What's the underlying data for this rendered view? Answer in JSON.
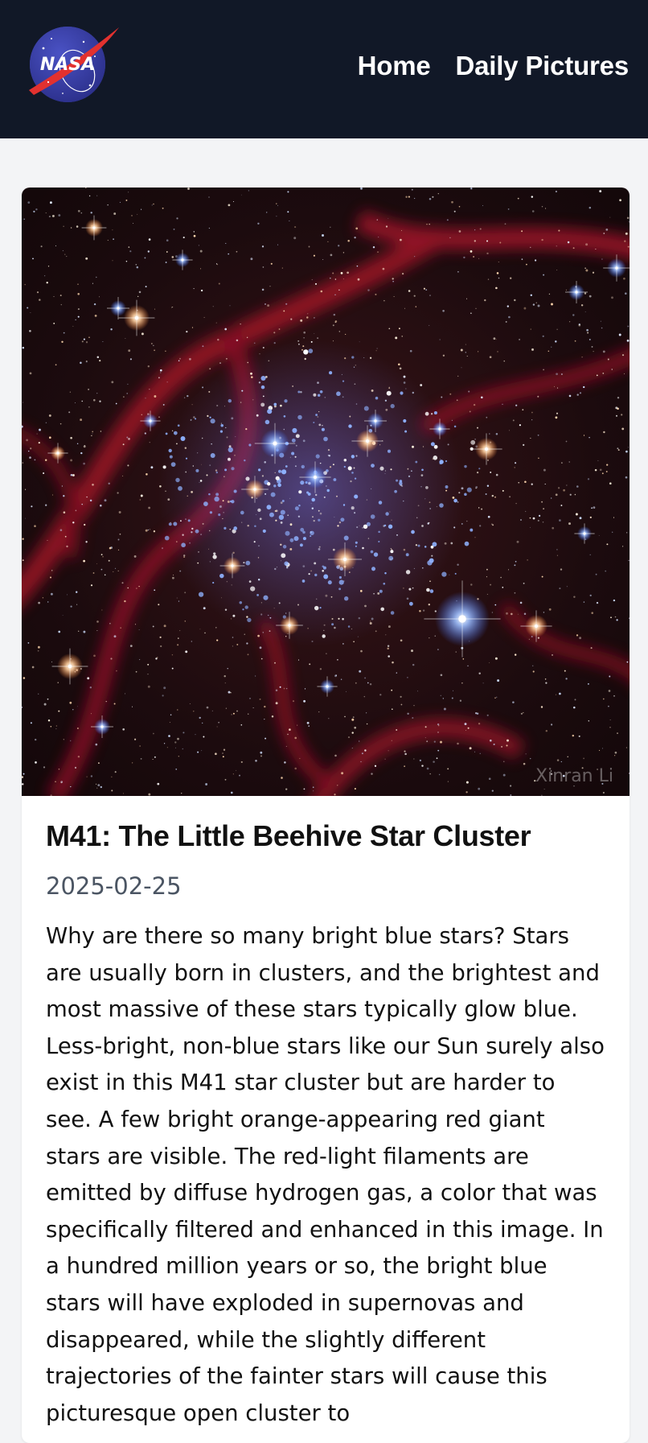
{
  "nav": {
    "logo_text": "NASA",
    "links": [
      {
        "label": "Home"
      },
      {
        "label": "Daily Pictures"
      }
    ]
  },
  "apod": {
    "image_credit": "Xinran Li",
    "title": "M41: The Little Beehive Star Cluster",
    "date": "2025-02-25",
    "description": "Why are there so many bright blue stars? Stars are usually born in clusters, and the brightest and most massive of these stars typically glow blue. Less-bright, non-blue stars like our Sun surely also exist in this M41 star cluster but are harder to see. A few bright orange-appearing red giant stars are visible. The red-light filaments are emitted by diffuse hydrogen gas, a color that was specifically filtered and enhanced in this image. In a hundred million years or so, the bright blue stars will have exploded in supernovas and disappeared, while the slightly different trajectories of the fainter stars will cause this picturesque open cluster to"
  },
  "colors": {
    "header_bg": "#111827",
    "page_bg": "#f3f4f6",
    "card_bg": "#ffffff",
    "nasa_blue": "#0b3d91",
    "nasa_red": "#fc3d21",
    "date_text": "#4b5563"
  },
  "icons": {
    "logo": "nasa-meatball-logo"
  }
}
